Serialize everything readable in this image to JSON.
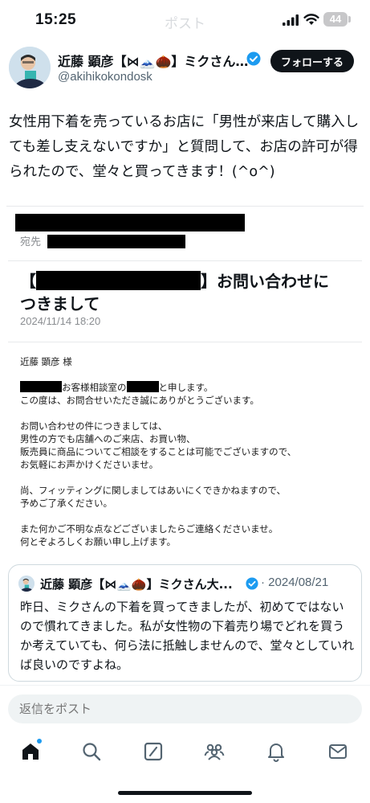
{
  "status_bar": {
    "time": "15:25",
    "faded_title": "ポスト",
    "battery": "44"
  },
  "author": {
    "name": "近藤 顕彦【⋈🗻🌰】ミクさん...",
    "handle": "@akihikokondosk",
    "follow_label": "フォローする"
  },
  "post": {
    "text": "女性用下着を売っているお店に「男性が来店して購入しても差し支えないですか」と質問して、お店の許可が得られたので、堂々と買ってきます！(^o^)"
  },
  "email": {
    "to_label": "宛先",
    "subject_open": "【",
    "subject_close": "】お問い合わせに",
    "subject_line2": "つきまして",
    "date": "2024/11/14 18:20",
    "salutation": "近藤 顕彦 様",
    "intro_line1_mid": "お客様相談室の",
    "intro_line1_end": "と申します。",
    "intro_line2": "この度は、お問合せいただき誠にありがとうございます。",
    "paragraph2": "お問い合わせの件につきましては、\n男性の方でも店舗へのご来店、お買い物、\n販売員に商品についてご相談をすることは可能でございますので、\nお気軽にお声かけくださいませ。",
    "paragraph3": "尚、フィッティングに関しましてはあいにくできかねますので、\n予めご了承ください。",
    "paragraph4": "また何かご不明な点などございましたらご連絡くださいませ。\n何とぞよろしくお願い申し上げます。"
  },
  "quoted": {
    "name": "近藤 顕彦【⋈🗻🌰】ミクさん大...",
    "date": "· 2024/08/21",
    "text": "昨日、ミクさんの下着を買ってきましたが、初めてではないので慣れてきました。私が女性物の下着売り場でどれを買うか考えていても、何ら法に抵触しませんので、堂々としていれば良いのですよね。"
  },
  "reply": {
    "placeholder": "返信をポスト"
  },
  "tabs": [
    "home",
    "search",
    "compose",
    "communities",
    "notifications",
    "messages"
  ],
  "colors": {
    "accent": "#1d9bf0",
    "text": "#0f1419",
    "muted": "#536471"
  }
}
